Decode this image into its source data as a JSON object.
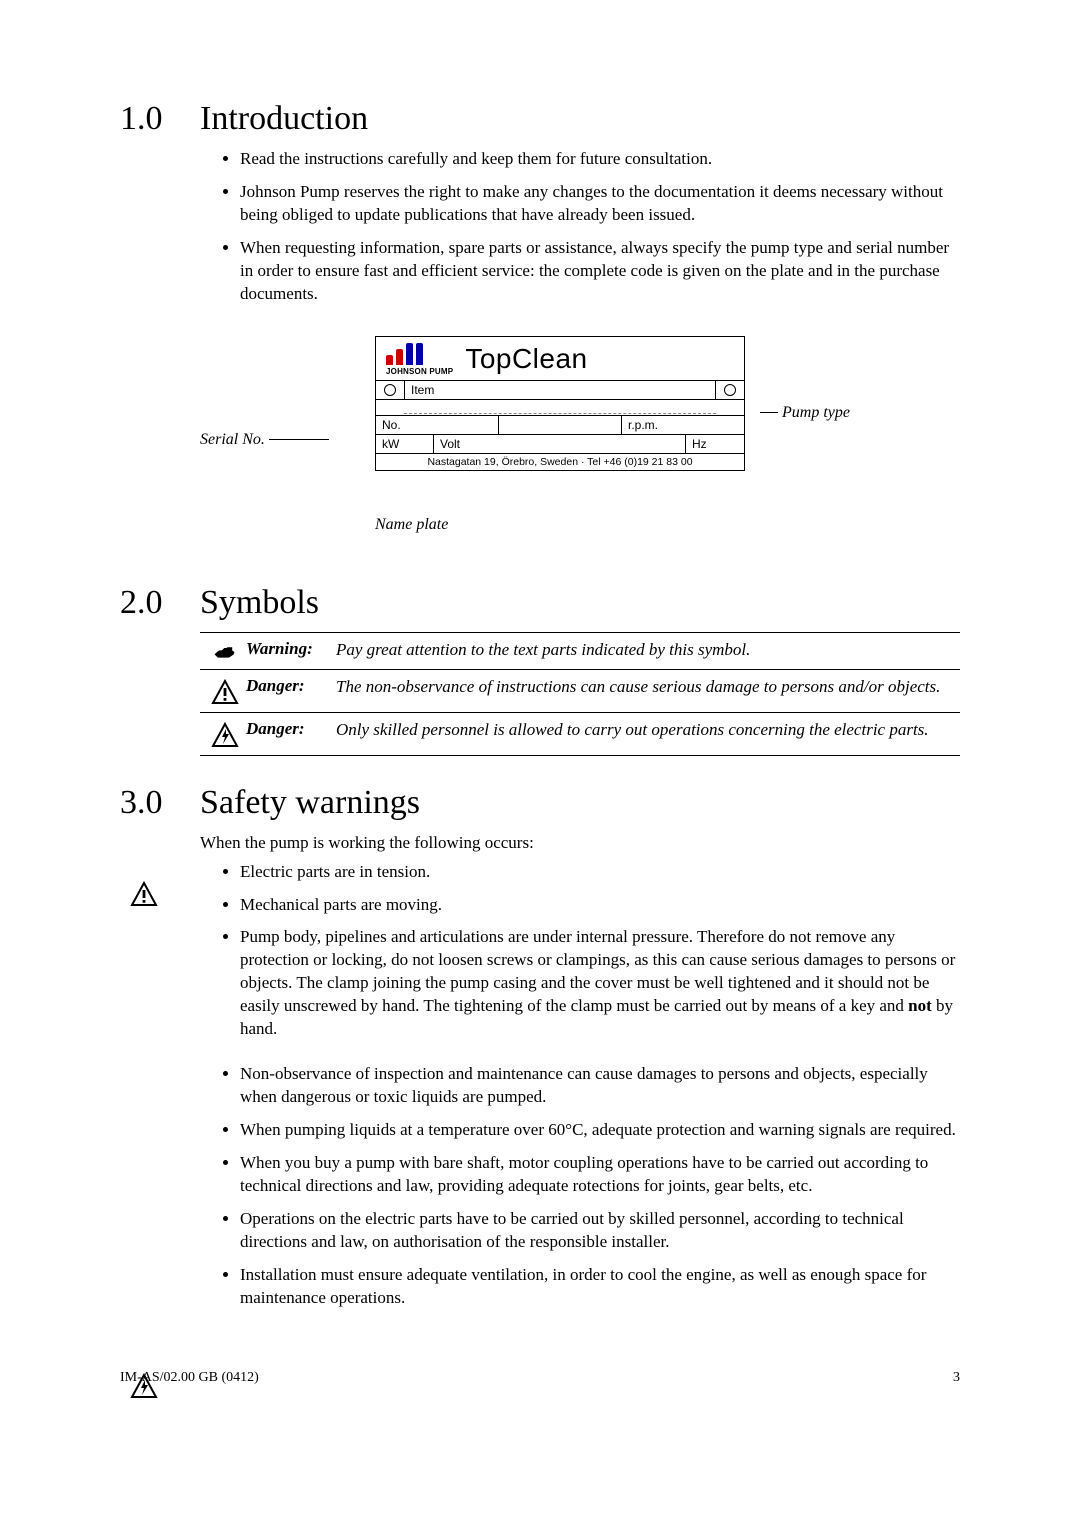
{
  "sections": {
    "intro": {
      "num": "1.0",
      "title": "Introduction",
      "bullets": [
        "Read the instructions carefully and keep them for future consultation.",
        "Johnson Pump reserves the right to make any changes to the documentation it deems necessary without being obliged to update publications that have already been issued.",
        "When requesting information, spare parts or assistance, always specify the pump type and serial number in order to ensure fast and efficient service: the complete code is given on the plate and in the purchase documents."
      ]
    },
    "symbols": {
      "num": "2.0",
      "title": "Symbols",
      "rows": [
        {
          "icon": "hand",
          "label": "Warning:",
          "text": "Pay great attention to the text parts indicated by this symbol."
        },
        {
          "icon": "danger",
          "label": "Danger:",
          "text": "The non-observance of instructions can cause serious damage to persons and/or objects."
        },
        {
          "icon": "electric",
          "label": "Danger:",
          "text": "Only skilled personnel is allowed to carry out operations concerning the electric parts."
        }
      ]
    },
    "safety": {
      "num": "3.0",
      "title": "Safety warnings",
      "intro": "When the pump is working the following occurs:",
      "bullets": [
        {
          "text": "Electric parts are in tension."
        },
        {
          "text": "Mechanical parts are moving."
        },
        {
          "pre": "Pump body, pipelines and articulations are under internal pressure. Therefore do not remove any protection or locking, do not loosen screws or clampings, as this can cause serious damages to persons or objects. The clamp joining the pump casing and the cover must be well tightened and it should not be easily unscrewed by hand. The tightening of the clamp must be carried out by means of a key and ",
          "bold": "not",
          "post": " by hand."
        },
        {
          "text": "Non-observance of inspection and maintenance can cause damages to persons and objects, especially when dangerous or toxic liquids are pumped."
        },
        {
          "text": "When pumping liquids at a temperature over 60°C, adequate protection and warning signals are required."
        },
        {
          "text": "When you buy a pump with bare shaft, motor coupling operations have to be carried out according to technical directions and law, providing adequate rotections for joints, gear belts, etc."
        },
        {
          "text": "Operations on the electric parts have to be carried out by skilled personnel, according to technical directions and law, on authorisation of the responsible installer."
        },
        {
          "text": "Installation must ensure adequate ventilation, in order to cool the engine, as well as enough space for maintenance operations."
        }
      ]
    }
  },
  "nameplate": {
    "brand_small": "JOHNSON PUMP",
    "brand_title": "TopClean",
    "item_label": "Item",
    "no_label": "No.",
    "rpm_label": "r.p.m.",
    "kw_label": "kW",
    "volt_label": "Volt",
    "hz_label": "Hz",
    "address": "Nastagatan 19, Örebro, Sweden · Tel +46 (0)19 21 83 00",
    "callout_serial": "Serial No.",
    "callout_type": "Pump type",
    "caption": "Name plate"
  },
  "footer": {
    "doc_code": "IM-AS/02.00 GB (0412)",
    "page_no": "3"
  }
}
